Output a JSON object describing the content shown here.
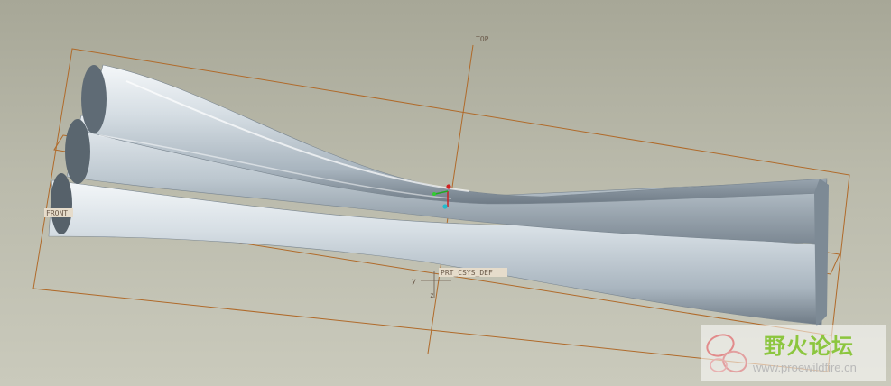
{
  "datums": {
    "top_plane": "TOP",
    "front_plane": "FRONT",
    "csys": "PRT_CSYS_DEF",
    "axis_y": "y",
    "axis_z": "z"
  },
  "watermark": {
    "title": "野火论坛",
    "url": "www.proewildfire.cn"
  },
  "colors": {
    "background": "#b4b4a4",
    "datum": "#b06a2a",
    "model": "#cdd6dd"
  }
}
